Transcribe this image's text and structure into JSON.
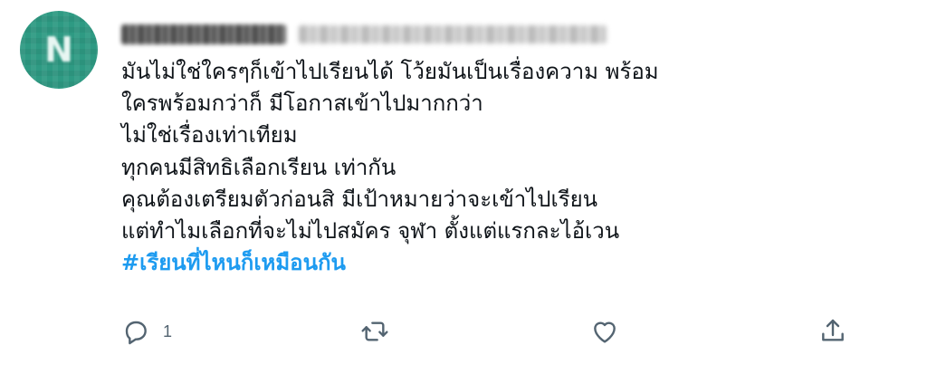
{
  "author": {
    "avatar_letter": "N",
    "avatar_color": "#2e9a83"
  },
  "tweet": {
    "lines": [
      "มันไม่ใช่ใครๆก็เข้าไปเรียนได้ โว้ยมันเป็นเรื่องความ พร้อม",
      "ใครพร้อมกว่าก็ มีโอกาสเข้าไปมากกว่า",
      "ไม่ใช่เรื่องเท่าเทียม",
      "ทุกคนมีสิทธิเลือกเรียน เท่ากัน",
      "คุณต้องเตรียมตัวก่อนสิ มีเป้าหมายว่าจะเข้าไปเรียน",
      "แต่ทำไมเลือกที่จะไม่ไปสมัคร จุฬา ตั้งแต่แรกละไอ้เวน"
    ],
    "hashtag": "#เรียนที่ไหนก็เหมือนกัน",
    "hashtag_color": "#1d9bf0"
  },
  "actions": {
    "reply_icon": "reply-icon",
    "reply_count": "1",
    "retweet_icon": "retweet-icon",
    "like_icon": "heart-icon",
    "share_icon": "share-icon",
    "icon_color": "#536471"
  }
}
